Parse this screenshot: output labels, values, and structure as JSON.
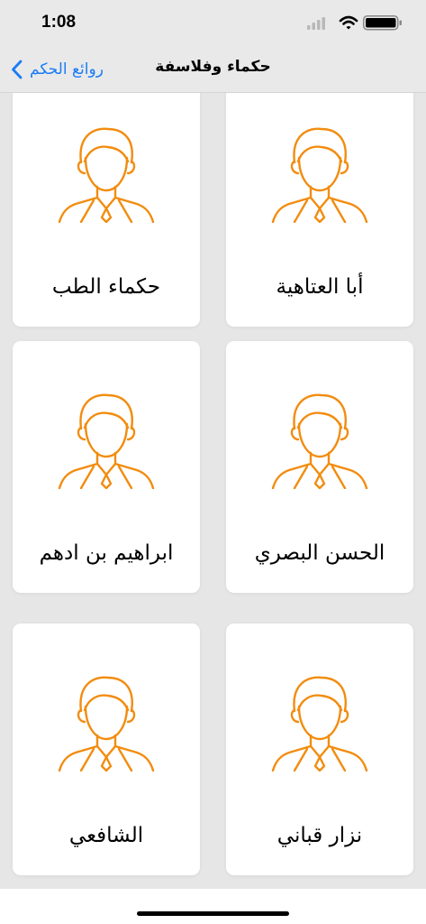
{
  "status_bar": {
    "time": "1:08",
    "icons": [
      "cellular-signal-icon",
      "wifi-icon",
      "battery-icon"
    ]
  },
  "nav": {
    "back_label": "روائع الحكم",
    "title": "حكماء وفلاسفة",
    "accent_color": "#1a7cf5"
  },
  "avatar_color": "#f28c0f",
  "cards": [
    {
      "name": "أبا العتاهية"
    },
    {
      "name": "حكماء الطب"
    },
    {
      "name": "الحسن البصري"
    },
    {
      "name": "ابراهيم بن ادهم"
    },
    {
      "name": "نزار قباني"
    },
    {
      "name": "الشافعي"
    }
  ]
}
